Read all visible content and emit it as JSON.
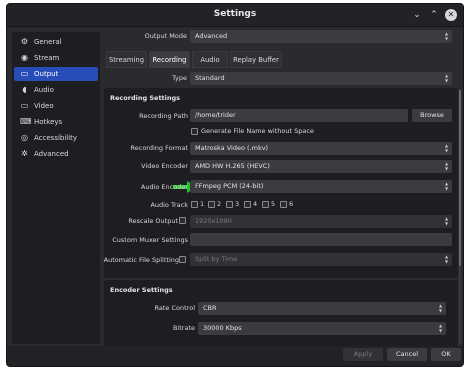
{
  "window": {
    "title": "Settings",
    "minimize_glyph": "⌄",
    "maximize_glyph": "⌃",
    "close_glyph": "✕"
  },
  "sidebar": {
    "items": [
      {
        "label": "General",
        "icon": "gear-icon",
        "glyph": "⚙"
      },
      {
        "label": "Stream",
        "icon": "globe-icon",
        "glyph": "◉"
      },
      {
        "label": "Output",
        "icon": "output-icon",
        "glyph": "▭"
      },
      {
        "label": "Audio",
        "icon": "audio-icon",
        "glyph": "◖"
      },
      {
        "label": "Video",
        "icon": "monitor-icon",
        "glyph": "▭"
      },
      {
        "label": "Hotkeys",
        "icon": "keyboard-icon",
        "glyph": "⌨"
      },
      {
        "label": "Accessibility",
        "icon": "accessibility-icon",
        "glyph": "◎"
      },
      {
        "label": "Advanced",
        "icon": "wrench-icon",
        "glyph": "✲"
      }
    ],
    "active": "Output"
  },
  "output_mode": {
    "label": "Output Mode",
    "value": "Advanced"
  },
  "tabs": [
    {
      "label": "Streaming"
    },
    {
      "label": "Recording"
    },
    {
      "label": "Audio"
    },
    {
      "label": "Replay Buffer"
    }
  ],
  "type": {
    "label": "Type",
    "value": "Standard"
  },
  "recording_settings": {
    "title": "Recording Settings",
    "path_label": "Recording Path",
    "path_value": "/home/trider",
    "browse_label": "Browse",
    "generate_label": "Generate File Name without Space",
    "format_label": "Recording Format",
    "format_value": "Matroska Video (.mkv)",
    "video_encoder_label": "Video Encoder",
    "video_encoder_value": "AMD HW H.265 (HEVC)",
    "audio_encoder_label": "Audio Encoder",
    "audio_encoder_value": "FFmpeg PCM (24-bit)",
    "audio_track_label": "Audio Track",
    "tracks": [
      "1",
      "2",
      "3",
      "4",
      "5",
      "6"
    ],
    "rescale_label": "Rescale Output",
    "rescale_value": "1920x1080",
    "custom_muxer_label": "Custom Muxer Settings",
    "custom_muxer_value": "",
    "split_label": "Automatic File Splitting",
    "split_value": "Split by Time"
  },
  "encoder_settings": {
    "title": "Encoder Settings",
    "rate_control_label": "Rate Control",
    "rate_control_value": "CBR",
    "bitrate_label": "Bitrate",
    "bitrate_value": "30000 Kbps"
  },
  "footer": {
    "apply_label": "Apply",
    "cancel_label": "Cancel",
    "ok_label": "OK"
  },
  "colors": {
    "accent": "#284cb8",
    "arrow": "#22c22a",
    "background": "#2b2b2f"
  }
}
